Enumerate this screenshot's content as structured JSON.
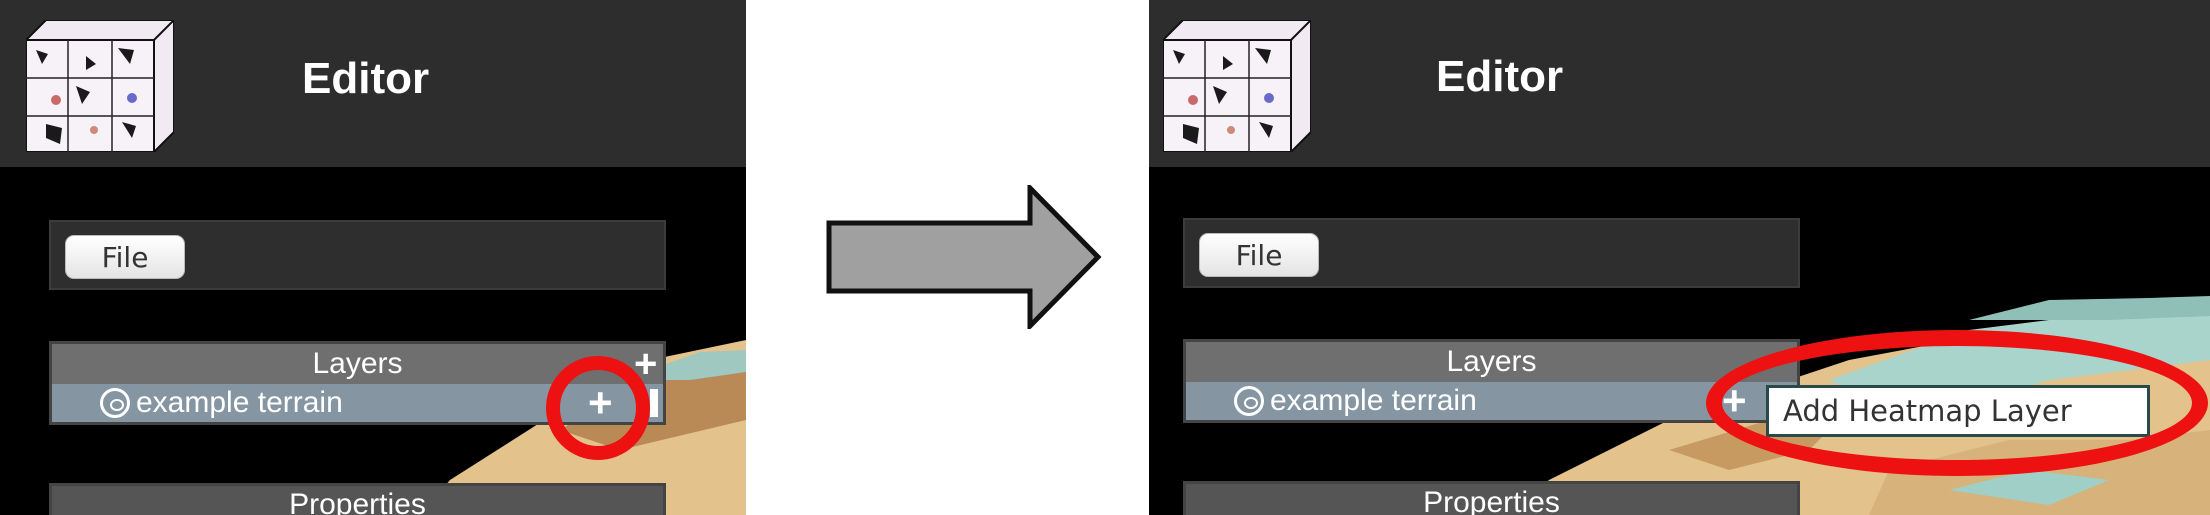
{
  "before": {
    "app_title": "Editor",
    "file_button": "File",
    "layers_header": "Layers",
    "layer_name": "example terrain",
    "properties_header": "Properties",
    "add_icon": "+"
  },
  "after": {
    "app_title": "Editor",
    "file_button": "File",
    "layers_header": "Layers",
    "layer_name": "example terrain",
    "properties_header": "Properties",
    "context_menu_item": "Add Heatmap Layer"
  },
  "annotations": {
    "highlight_color": "#ee1111",
    "arrow_color": "#a0a0a0"
  }
}
